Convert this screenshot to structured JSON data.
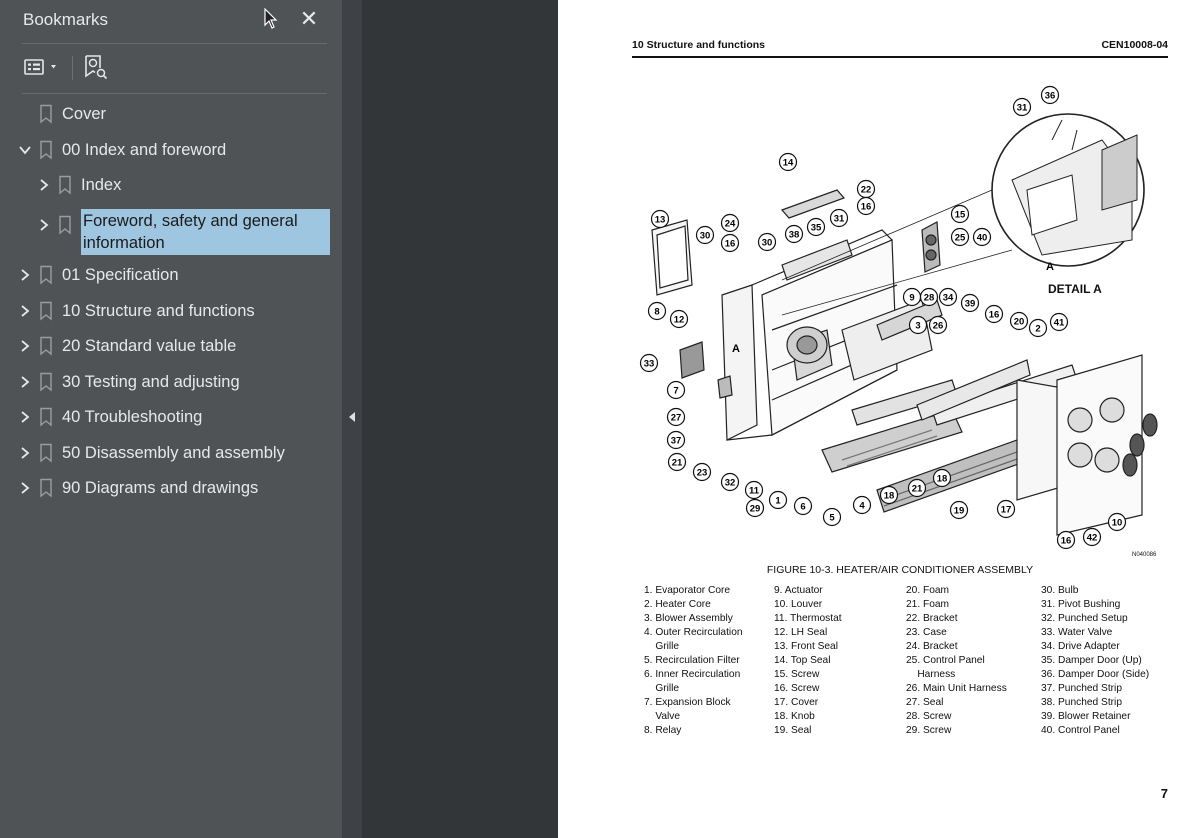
{
  "sidebar": {
    "title": "Bookmarks",
    "close_label": "✕",
    "toolbar": {
      "options_icon": "list-options-icon",
      "find_icon": "find-bookmark-icon"
    },
    "items": [
      {
        "label": "Cover",
        "expand": "none",
        "level": 0
      },
      {
        "label": "00 Index and foreword",
        "expand": "expanded",
        "level": 0
      },
      {
        "label": "Index",
        "expand": "collapsed",
        "level": 1
      },
      {
        "label": "Foreword, safety and general information",
        "expand": "collapsed",
        "level": 1,
        "selected": true
      },
      {
        "label": "01 Specification",
        "expand": "collapsed",
        "level": 0
      },
      {
        "label": "10 Structure and functions",
        "expand": "collapsed",
        "level": 0
      },
      {
        "label": "20 Standard value table",
        "expand": "collapsed",
        "level": 0
      },
      {
        "label": "30 Testing and adjusting",
        "expand": "collapsed",
        "level": 0
      },
      {
        "label": "40 Troubleshooting",
        "expand": "collapsed",
        "level": 0
      },
      {
        "label": "50 Disassembly and assembly",
        "expand": "collapsed",
        "level": 0
      },
      {
        "label": "90 Diagrams and drawings",
        "expand": "collapsed",
        "level": 0
      }
    ]
  },
  "page": {
    "running_head_left": "10 Structure and functions",
    "running_head_right": "CEN10008-04",
    "detail_label": "DETAIL A",
    "drawing_number": "N040086",
    "caption": "FIGURE 10-3. HEATER/AIR CONDITIONER ASSEMBLY",
    "callouts": [
      "14",
      "31",
      "36",
      "22",
      "16",
      "13",
      "30",
      "24",
      "16",
      "30",
      "38",
      "35",
      "31",
      "15",
      "25",
      "40",
      "9",
      "28",
      "34",
      "8",
      "12",
      "39",
      "3",
      "26",
      "16",
      "20",
      "2",
      "41",
      "33",
      "A",
      "7",
      "27",
      "37",
      "21",
      "23",
      "32",
      "11",
      "29",
      "1",
      "6",
      "5",
      "4",
      "18",
      "21",
      "18",
      "19",
      "17",
      "10",
      "42",
      "16",
      "A"
    ],
    "legend": [
      [
        "1. Evaporator Core",
        "2. Heater Core",
        "3. Blower Assembly",
        "4. Outer Recirculation",
        "    Grille",
        "5. Recirculation Filter",
        "6. Inner Recirculation",
        "    Grille",
        "7. Expansion Block",
        "    Valve",
        "8. Relay"
      ],
      [
        "9. Actuator",
        "10. Louver",
        "11. Thermostat",
        "12. LH Seal",
        "13. Front Seal",
        "14. Top Seal",
        "15. Screw",
        "16. Screw",
        "17. Cover",
        "18. Knob",
        "19. Seal"
      ],
      [
        "20. Foam",
        "21. Foam",
        "22. Bracket",
        "23. Case",
        "24. Bracket",
        "25. Control Panel",
        "    Harness",
        "26. Main Unit Harness",
        "27. Seal",
        "28. Screw",
        "29. Screw"
      ],
      [
        "30. Bulb",
        "31. Pivot Bushing",
        "32. Punched Setup",
        "33. Water Valve",
        "34. Drive Adapter",
        "35. Damper Door (Up)",
        "36. Damper Door (Side)",
        "37. Punched Strip",
        "38. Punched Strip",
        "39. Blower Retainer",
        "40. Control Panel"
      ]
    ],
    "page_number": "7"
  }
}
